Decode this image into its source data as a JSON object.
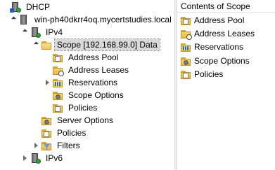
{
  "tree": {
    "root": "DHCP",
    "server": "win-ph40dkrr4oq.mycertstudies.local",
    "ipv4": "IPv4",
    "scope": "Scope [192.168.99.0] Data",
    "scope_children": [
      "Address Pool",
      "Address Leases",
      "Reservations",
      "Scope Options",
      "Policies"
    ],
    "ipv4_children": [
      "Server Options",
      "Policies",
      "Filters"
    ],
    "ipv6": "IPv6"
  },
  "list": {
    "header": "Contents of Scope",
    "items": [
      "Address Pool",
      "Address Leases",
      "Reservations",
      "Scope Options",
      "Policies"
    ]
  }
}
